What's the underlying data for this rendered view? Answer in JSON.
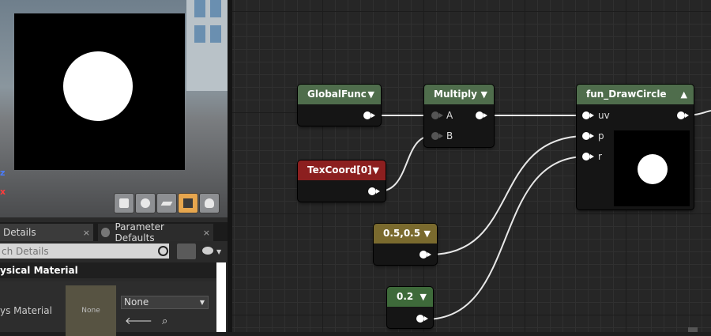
{
  "viewport": {
    "axis_z": "z",
    "axis_x": "x",
    "shape_buttons": [
      "cylinder-icon",
      "sphere-icon",
      "plane-icon",
      "cube-icon",
      "teapot-icon"
    ],
    "active_shape": "cube-icon"
  },
  "details": {
    "tabs": [
      {
        "label": "Details",
        "close": "×"
      },
      {
        "label": "Parameter Defaults",
        "close": "×"
      }
    ],
    "search_placeholder": "ch Details",
    "category": "ysical Material",
    "property_label": "ys Material",
    "thumbnail_text": "None",
    "combo_value": "None"
  },
  "nodes": {
    "global_func": {
      "title": "GlobalFunc"
    },
    "multiply": {
      "title": "Multiply",
      "inputs": [
        "A",
        "B"
      ]
    },
    "texcoord": {
      "title": "TexCoord[0]"
    },
    "draw_circle": {
      "title": "fun_DrawCircle",
      "inputs": [
        "uv",
        "p",
        "r"
      ]
    },
    "const_p": {
      "title": "0.5,0.5"
    },
    "const_r": {
      "title": "0.2"
    }
  },
  "colors": {
    "func_header": "#4f6d4c",
    "texcoord_header": "#8c1f1f",
    "vector_header": "#7a6a2e",
    "scalar_header": "#3e6a3a",
    "accent": "#e6a64e"
  }
}
